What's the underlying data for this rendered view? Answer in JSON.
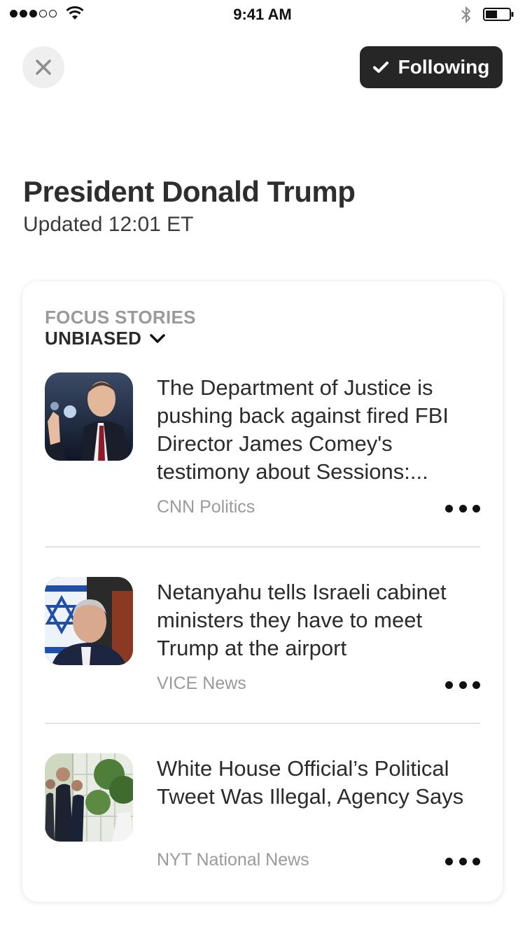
{
  "status_bar": {
    "time": "9:41 AM"
  },
  "header": {
    "follow_label": "Following",
    "title": "President Donald Trump",
    "updated": "Updated 12:01 ET"
  },
  "card": {
    "section_label": "FOCUS STORIES",
    "filter_label": "UNBIASED",
    "stories": [
      {
        "headline": "The Department of Justice is pushing back against fired FBI Director James Comey's testimony about Sessions:...",
        "source": "CNN Politics"
      },
      {
        "headline": "Netanyahu tells Israeli cabinet ministers they have to meet Trump at the airport",
        "source": "VICE News"
      },
      {
        "headline": "White House Official’s Political Tweet Was Illegal, Agency Says",
        "source": "NYT National News"
      }
    ]
  }
}
